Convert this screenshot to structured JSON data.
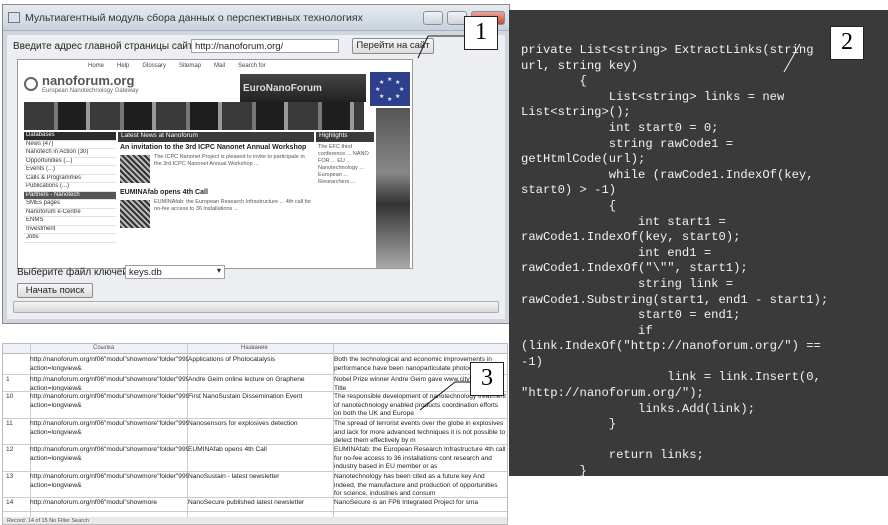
{
  "window": {
    "title": "Мультиагентный модуль сбора данных о перспективных технологиях",
    "url_label": "Введите адрес главной страницы сайта",
    "url_value": "http://nanoforum.org/",
    "go_button": "Перейти на сайт",
    "keyfile_label": "Выберите файл ключей",
    "keyfile_value": "keys.db",
    "search_button": "Начать поиск"
  },
  "browser": {
    "nav": [
      "Home",
      "Help",
      "Glossary",
      "Sitemap",
      "Mail",
      "Search for"
    ],
    "logo": "nanoforum.org",
    "tagline": "European Nanotechnology Gateway",
    "banner": "EuroNanoForum",
    "sidebar": [
      "Databases",
      "News (47)",
      "Nanotech in Action (30)",
      "Opportunities (...)",
      "Events (...)",
      "Calls & Programmes",
      "Publications (...)",
      "Partners - Nanotech",
      "SMEs pages",
      "Nanoforum e-Centre",
      "ENMS",
      "Investment",
      "Jobs"
    ],
    "news_header": "Latest News at Nanoforum",
    "news": [
      {
        "title": "An invitation to the 3rd ICPC Nanonet Annual Workshop",
        "body": "The ICPC Nanonet Project is pleased to invite to participate in the 3rd ICPC Nanonet Annual Workshop ..."
      },
      {
        "title": "EUMINAfab opens 4th Call",
        "body": "EUMINAfab: the European Research Infrastructure ... 4th call for no-fee access to 36 installations ..."
      }
    ],
    "highlight_header": "Highlights",
    "highlight_text": "The EFC third conference ... NANO FOR ... EU ... Nanotechnology ... European ... Researchers ..."
  },
  "code": {
    "lines": [
      "private List<string> ExtractLinks(string",
      "url, string key)",
      "        {",
      "            List<string> links = new",
      "List<string>();",
      "            int start0 = 0;",
      "            string rawCode1 =",
      "getHtmlCode(url);",
      "            while (rawCode1.IndexOf(key,",
      "start0) > -1)",
      "            {",
      "                int start1 =",
      "rawCode1.IndexOf(key, start0);",
      "                int end1 =",
      "rawCode1.IndexOf(\"\\\"\", start1);",
      "                string link =",
      "rawCode1.Substring(start1, end1 - start1);",
      "                start0 = end1;",
      "                if",
      "(link.IndexOf(\"http://nanoforum.org/\") ==",
      "-1)",
      "                    link = link.Insert(0,",
      "\"http://nanoforum.org/\");",
      "                links.Add(link);",
      "            }",
      "",
      "            return links;",
      "        }"
    ]
  },
  "table": {
    "headers": [
      "Ссылка",
      "Название"
    ],
    "rows": [
      {
        "id": "",
        "link": "http://nanoforum.org/nf06\"modul\"showmore\"folder\"99999\"scc\"news\"scid\"4194\".html?action=longview&",
        "name": "Applications of Photocatalysis",
        "desc": "Both the technological and economic improvements in performance have been nanoparticulate photocatalysts has"
      },
      {
        "id": "1",
        "link": "http://nanoforum.org/nf06\"modul\"showmore\"folder\"99999\"scc\"news\"scid\"4185\".html?action=longview&",
        "name": "Andre Geim online lecture on Graphene",
        "desc": "Nobel Prize winner Andre Geim gave www.citytv.nlh for Title"
      },
      {
        "id": "10",
        "link": "http://nanoforum.org/nf06\"modul\"showmore\"folder\"99999\"scc\"news\"scid\"4208\".html?action=longview&",
        "name": "First NanoSustain Dissemination Event",
        "desc": "The responsible development of nanotechnology treatment of nanotechnology enabled products coordination efforts on both the UK and Europe"
      },
      {
        "id": "11",
        "link": "http://nanoforum.org/nf06\"modul\"showmore\"folder\"99999\"scc\"news\"scid\"4204\".html?action=longview&",
        "name": "Nanosensors for explosives detection",
        "desc": "The spread of terrorist events over the globe in explosives and lack for more advanced techniques it is not possible to detect them effectively by m"
      },
      {
        "id": "12",
        "link": "http://nanoforum.org/nf06\"modul\"showmore\"folder\"99999\"scc\"news\"scid\"4202\".html?action=longview&",
        "name": "EUMINAfab opens 4th Call",
        "desc": "EUMINAfab: the European Research Infrastructure 4th call for no-fee access to 36 installations cont research and industry based in EU member or as"
      },
      {
        "id": "13",
        "link": "http://nanoforum.org/nf06\"modul\"showmore\"folder\"99999\"scc\"news\"scid\"4192\".html?action=longview&",
        "name": "NanoSustain - latest newsletter",
        "desc": "Nanotechnology has been cited as a future key And indeed, the manufacture and production of opportunities for science, industries and consum"
      },
      {
        "id": "14",
        "link": "http://nanoforum.org/nf06\"modul\"showmore",
        "name": "NanoSecure published latest newsletter",
        "desc": "NanoSecure is an FP6 Integrated Project for sma"
      }
    ],
    "footer": "Record: 14 of 15  No Filter  Search"
  },
  "callouts": [
    "1",
    "2",
    "3"
  ]
}
